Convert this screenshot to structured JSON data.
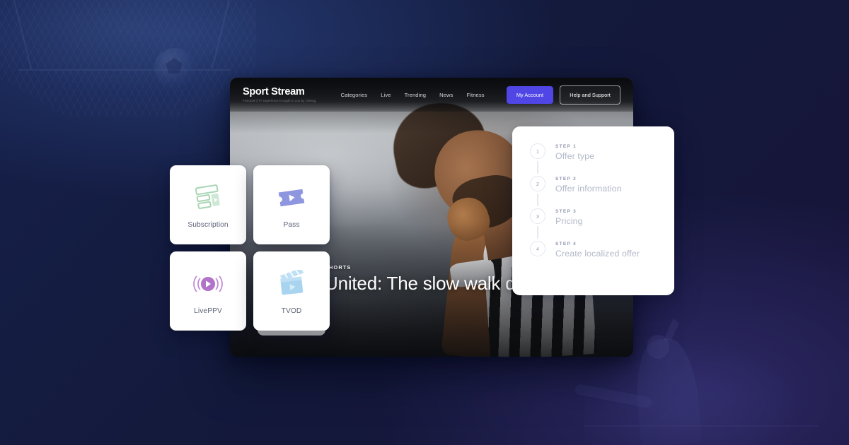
{
  "background": {
    "accent_navy": "#141c3e",
    "accent_purple": "#2c2669",
    "decor_top_left": "stadium-goal-net-and-football",
    "decor_bottom_right": "athlete-silhouette"
  },
  "app": {
    "brand": {
      "name": "Sport Stream",
      "tagline": "Fictional OTT experience brought to you by Cleeng."
    },
    "nav_links": [
      {
        "label": "Categories"
      },
      {
        "label": "Live"
      },
      {
        "label": "Trending"
      },
      {
        "label": "News"
      },
      {
        "label": "Fitness"
      }
    ],
    "actions": {
      "account_label": "My Account",
      "account_color": "#4f46e5",
      "help_label": "Help and Support"
    },
    "hero": {
      "kicker": "SHORTS",
      "title": "United: The slow walk down"
    }
  },
  "offer_types": {
    "cards": [
      {
        "label": "Subscription",
        "icon": "subscription-list-icon",
        "color": "#a8d5b4"
      },
      {
        "label": "Pass",
        "icon": "ticket-icon",
        "color": "#8f96e0"
      },
      {
        "label": "LivePPV",
        "icon": "live-broadcast-play-icon",
        "color": "#b074c8"
      },
      {
        "label": "TVOD",
        "icon": "clapperboard-icon",
        "color": "#a9d4ef"
      }
    ]
  },
  "steps_panel": {
    "steps": [
      {
        "number": "1",
        "kicker": "STEP 1",
        "title": "Offer type"
      },
      {
        "number": "2",
        "kicker": "STEP 2",
        "title": "Offer information"
      },
      {
        "number": "3",
        "kicker": "STEP 3",
        "title": "Pricing"
      },
      {
        "number": "4",
        "kicker": "STEP 4",
        "title": "Create localized offer"
      }
    ]
  }
}
